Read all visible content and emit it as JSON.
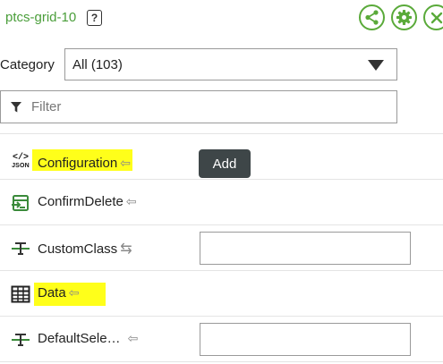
{
  "header": {
    "title": "ptcs-grid-10",
    "help_label": "?",
    "buttons": [
      "share-icon",
      "gear-icon",
      "close-icon"
    ]
  },
  "category": {
    "label": "Category",
    "selected": "All (103)"
  },
  "filter": {
    "placeholder": "Filter",
    "value": ""
  },
  "properties": [
    {
      "name": "Configuration",
      "icon": "json-icon",
      "control": "button",
      "control_label": "Add",
      "icon_label": "JSON"
    },
    {
      "name": "ConfirmDelete",
      "icon": "event-icon",
      "control": "none"
    },
    {
      "name": "CustomClass",
      "icon": "string-icon",
      "control": "input",
      "value": ""
    },
    {
      "name": "Data",
      "icon": "table-icon",
      "control": "none"
    },
    {
      "name": "DefaultSele…",
      "icon": "string-icon",
      "control": "input",
      "value": ""
    }
  ],
  "colors": {
    "accent_green": "#5aaa3a",
    "highlight": "#ffff1a",
    "button_dark": "#3e4648"
  }
}
